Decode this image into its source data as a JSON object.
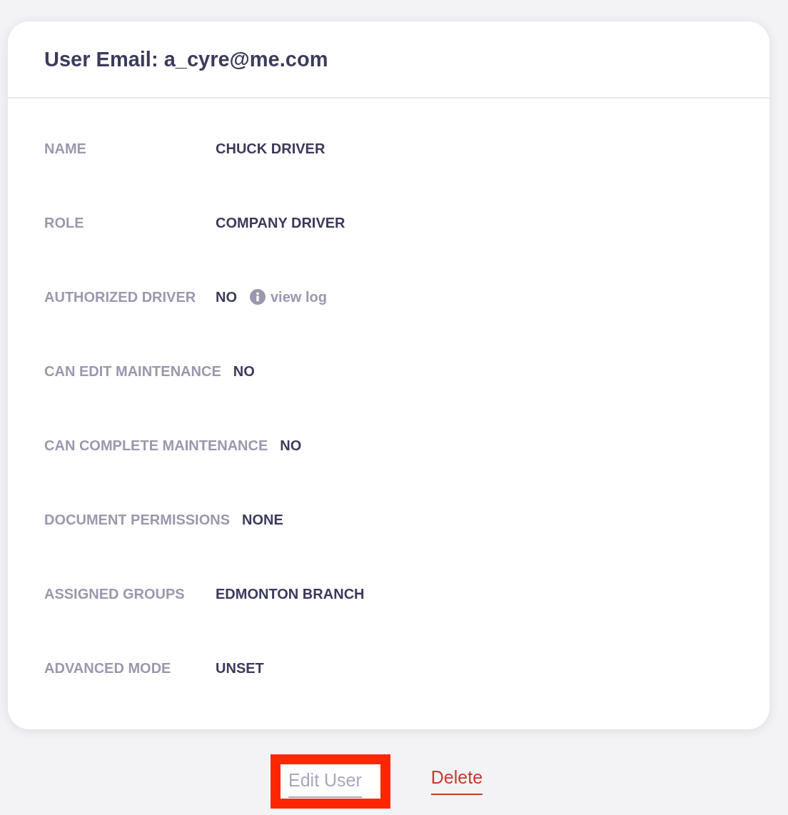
{
  "header": {
    "title": "User Email: a_cyre@me.com"
  },
  "fields": [
    {
      "label": "NAME",
      "value": "CHUCK DRIVER"
    },
    {
      "label": "ROLE",
      "value": "COMPANY DRIVER"
    },
    {
      "label": "AUTHORIZED DRIVER",
      "value": "NO",
      "link": "view log"
    },
    {
      "label": "CAN EDIT MAINTENANCE",
      "value": "NO"
    },
    {
      "label": "CAN COMPLETE MAINTENANCE",
      "value": "NO"
    },
    {
      "label": "DOCUMENT PERMISSIONS",
      "value": "NONE"
    },
    {
      "label": "ASSIGNED GROUPS",
      "value": "EDMONTON BRANCH"
    },
    {
      "label": "ADVANCED MODE",
      "value": "UNSET"
    }
  ],
  "actions": [
    {
      "kind": "secondary",
      "label": "Edit User",
      "highlighted": true
    },
    {
      "kind": "danger",
      "label": "Delete",
      "highlighted": false
    }
  ]
}
